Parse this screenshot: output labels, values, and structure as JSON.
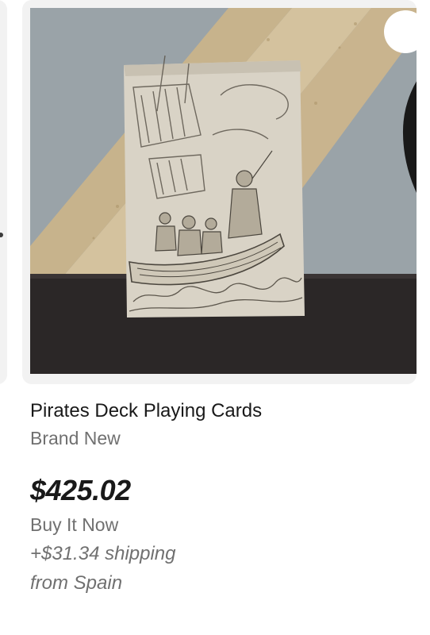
{
  "listing": {
    "title": "Pirates Deck Playing Cards",
    "condition": "Brand New",
    "price": "$425.02",
    "buying_format": "Buy It Now",
    "shipping": "+$31.34 shipping",
    "location": "from Spain",
    "image_icon": "product-photo",
    "watch_icon": "heart-icon"
  }
}
